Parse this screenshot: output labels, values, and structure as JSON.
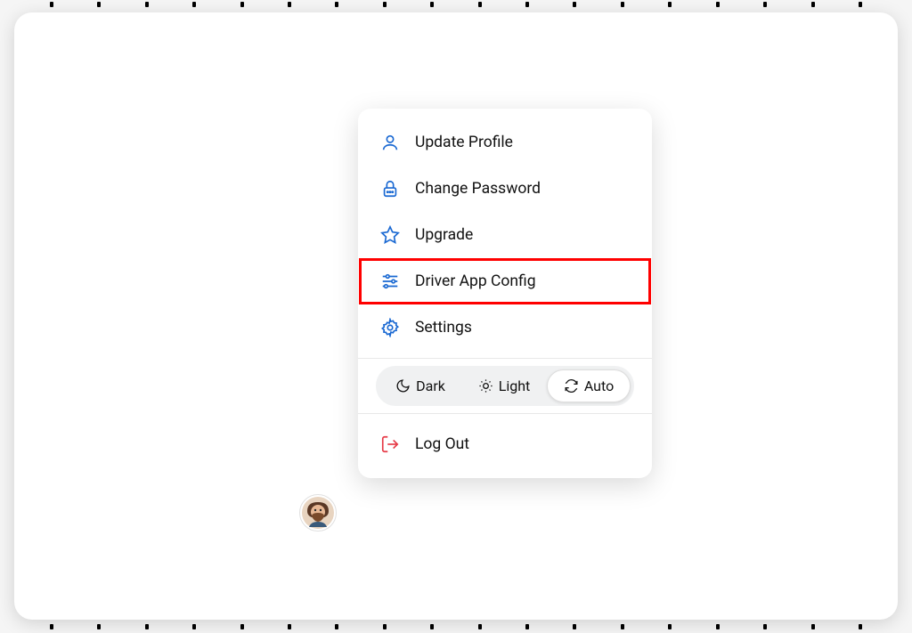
{
  "menu": {
    "items": [
      {
        "label": "Update Profile"
      },
      {
        "label": "Change Password"
      },
      {
        "label": "Upgrade"
      },
      {
        "label": "Driver App Config"
      },
      {
        "label": "Settings"
      }
    ],
    "theme": {
      "options": [
        {
          "label": "Dark"
        },
        {
          "label": "Light"
        },
        {
          "label": "Auto"
        }
      ],
      "active": "Auto"
    },
    "logout_label": "Log Out"
  }
}
